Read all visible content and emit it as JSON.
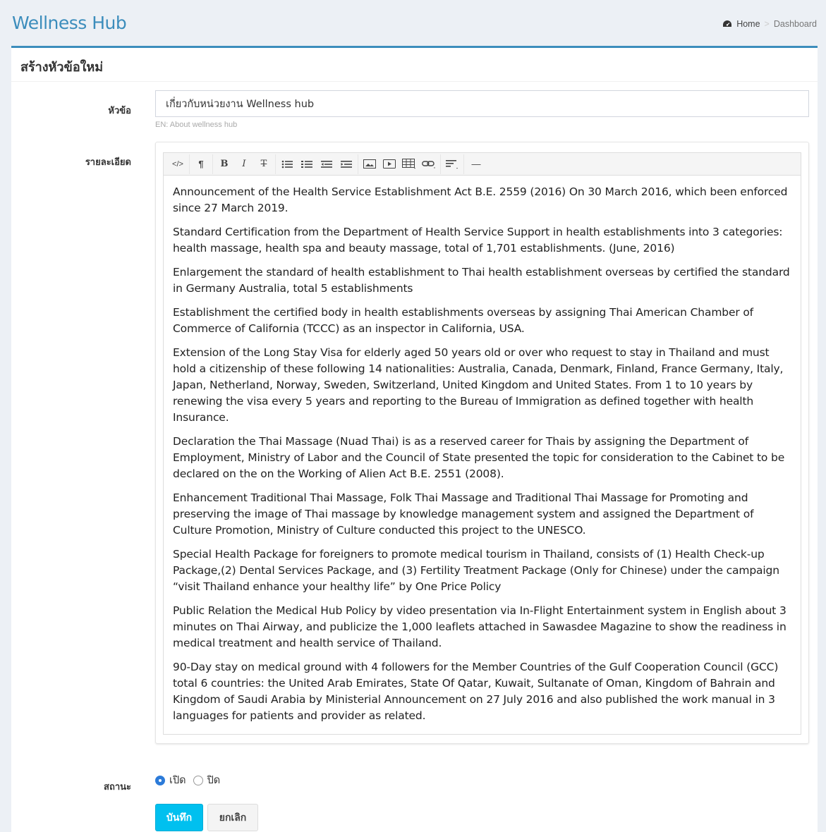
{
  "header": {
    "app_title": "Wellness Hub",
    "breadcrumb_home": "Home",
    "breadcrumb_separator": ">",
    "breadcrumb_current": "Dashboard"
  },
  "box": {
    "title": "สร้างหัวข้อใหม่"
  },
  "form": {
    "topic_label": "หัวข้อ",
    "topic_value": "เกี่ยวกับหน่วยงาน Wellness hub",
    "topic_hint": "EN: About wellness hub",
    "detail_label": "รายละเอียด",
    "status_label": "สถานะ",
    "status_options": [
      "เปิด",
      "ปิด"
    ],
    "status_selected": "เปิด",
    "save_label": "บันทึก",
    "cancel_label": "ยกเลิก"
  },
  "toolbar": {
    "code": "</>",
    "paragraph": "¶",
    "bold": "B",
    "italic": "I",
    "strike": "T",
    "hr": "—"
  },
  "content": {
    "paragraphs": [
      "Announcement of the Health Service Establishment Act B.E. 2559 (2016) On 30 March 2016, which been enforced since 27 March 2019.",
      "Standard Certification from the Department of Health Service Support in health establishments into 3 categories: health massage, health spa and beauty massage, total of 1,701 establishments. (June, 2016)",
      "Enlargement the standard of health establishment to Thai health establishment overseas by certified the standard in Germany Australia, total 5 establishments",
      "Establishment the certified body in health establishments overseas by assigning Thai American Chamber of Commerce of California (TCCC) as an inspector in California, USA.",
      "Extension of the Long Stay Visa for elderly aged 50 years old or over who request to stay in Thailand and must hold a citizenship of these following 14 nationalities: Australia, Canada, Denmark, Finland, France Germany, Italy, Japan, Netherland, Norway, Sweden, Switzerland, United Kingdom and United States. From 1 to 10 years by renewing the visa every 5 years and reporting to the Bureau of Immigration as defined together with health Insurance.",
      "Declaration the Thai Massage (Nuad Thai) is as a reserved career for Thais by assigning the Department of Employment, Ministry of Labor and the Council of State presented the topic for consideration to the Cabinet to be declared on the on the Working of Alien Act B.E. 2551 (2008).",
      "Enhancement Traditional Thai Massage, Folk Thai Massage and Traditional Thai Massage for Promoting and preserving the image of Thai massage by knowledge management system and assigned the Department of Culture Promotion, Ministry of Culture conducted this project to the UNESCO.",
      "Special Health Package for foreigners to promote medical tourism in Thailand, consists of (1) Health Check-up Package,(2) Dental Services Package, and (3) Fertility Treatment Package (Only for Chinese) under the campaign “visit Thailand enhance your healthy life” by One Price Policy",
      "Public Relation the Medical Hub Policy by video presentation via In-Flight Entertainment system in English about 3 minutes on Thai Airway, and publicize the 1,000 leaflets attached in Sawasdee Magazine to show the readiness in medical treatment and health service of Thailand.",
      "90-Day stay on medical ground with 4 followers for the Member Countries of the Gulf Cooperation Council (GCC) total 6 countries: the United Arab Emirates, State Of Qatar, Kuwait, Sultanate of Oman, Kingdom of Bahrain and Kingdom of Saudi Arabia by Ministerial Announcement on 27 July 2016 and also published the work manual in 3 languages for patients and provider as related."
    ]
  },
  "colors": {
    "brand": "#3c8dbc",
    "save_button": "#00c0ef",
    "page_bg": "#ecf0f5"
  }
}
